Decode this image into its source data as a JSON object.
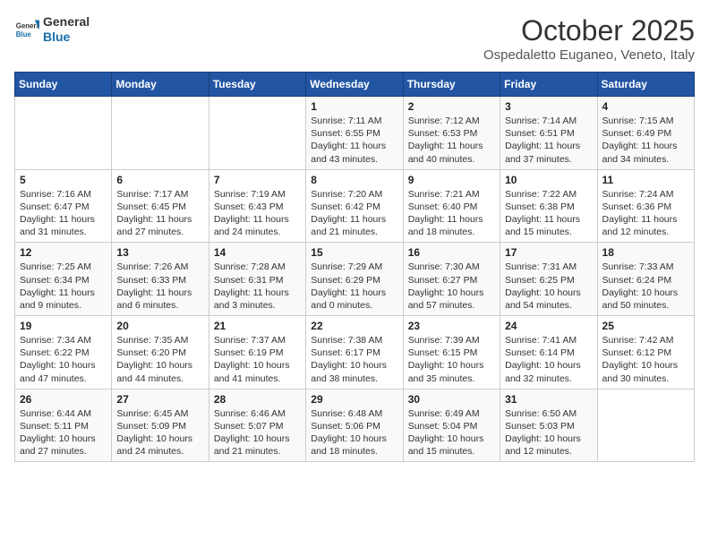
{
  "header": {
    "logo_general": "General",
    "logo_blue": "Blue",
    "month": "October 2025",
    "location": "Ospedaletto Euganeo, Veneto, Italy"
  },
  "weekdays": [
    "Sunday",
    "Monday",
    "Tuesday",
    "Wednesday",
    "Thursday",
    "Friday",
    "Saturday"
  ],
  "weeks": [
    [
      {
        "day": "",
        "info": ""
      },
      {
        "day": "",
        "info": ""
      },
      {
        "day": "",
        "info": ""
      },
      {
        "day": "1",
        "sunrise": "7:11 AM",
        "sunset": "6:55 PM",
        "daylight": "11 hours and 43 minutes."
      },
      {
        "day": "2",
        "sunrise": "7:12 AM",
        "sunset": "6:53 PM",
        "daylight": "11 hours and 40 minutes."
      },
      {
        "day": "3",
        "sunrise": "7:14 AM",
        "sunset": "6:51 PM",
        "daylight": "11 hours and 37 minutes."
      },
      {
        "day": "4",
        "sunrise": "7:15 AM",
        "sunset": "6:49 PM",
        "daylight": "11 hours and 34 minutes."
      }
    ],
    [
      {
        "day": "5",
        "sunrise": "7:16 AM",
        "sunset": "6:47 PM",
        "daylight": "11 hours and 31 minutes."
      },
      {
        "day": "6",
        "sunrise": "7:17 AM",
        "sunset": "6:45 PM",
        "daylight": "11 hours and 27 minutes."
      },
      {
        "day": "7",
        "sunrise": "7:19 AM",
        "sunset": "6:43 PM",
        "daylight": "11 hours and 24 minutes."
      },
      {
        "day": "8",
        "sunrise": "7:20 AM",
        "sunset": "6:42 PM",
        "daylight": "11 hours and 21 minutes."
      },
      {
        "day": "9",
        "sunrise": "7:21 AM",
        "sunset": "6:40 PM",
        "daylight": "11 hours and 18 minutes."
      },
      {
        "day": "10",
        "sunrise": "7:22 AM",
        "sunset": "6:38 PM",
        "daylight": "11 hours and 15 minutes."
      },
      {
        "day": "11",
        "sunrise": "7:24 AM",
        "sunset": "6:36 PM",
        "daylight": "11 hours and 12 minutes."
      }
    ],
    [
      {
        "day": "12",
        "sunrise": "7:25 AM",
        "sunset": "6:34 PM",
        "daylight": "11 hours and 9 minutes."
      },
      {
        "day": "13",
        "sunrise": "7:26 AM",
        "sunset": "6:33 PM",
        "daylight": "11 hours and 6 minutes."
      },
      {
        "day": "14",
        "sunrise": "7:28 AM",
        "sunset": "6:31 PM",
        "daylight": "11 hours and 3 minutes."
      },
      {
        "day": "15",
        "sunrise": "7:29 AM",
        "sunset": "6:29 PM",
        "daylight": "11 hours and 0 minutes."
      },
      {
        "day": "16",
        "sunrise": "7:30 AM",
        "sunset": "6:27 PM",
        "daylight": "10 hours and 57 minutes."
      },
      {
        "day": "17",
        "sunrise": "7:31 AM",
        "sunset": "6:25 PM",
        "daylight": "10 hours and 54 minutes."
      },
      {
        "day": "18",
        "sunrise": "7:33 AM",
        "sunset": "6:24 PM",
        "daylight": "10 hours and 50 minutes."
      }
    ],
    [
      {
        "day": "19",
        "sunrise": "7:34 AM",
        "sunset": "6:22 PM",
        "daylight": "10 hours and 47 minutes."
      },
      {
        "day": "20",
        "sunrise": "7:35 AM",
        "sunset": "6:20 PM",
        "daylight": "10 hours and 44 minutes."
      },
      {
        "day": "21",
        "sunrise": "7:37 AM",
        "sunset": "6:19 PM",
        "daylight": "10 hours and 41 minutes."
      },
      {
        "day": "22",
        "sunrise": "7:38 AM",
        "sunset": "6:17 PM",
        "daylight": "10 hours and 38 minutes."
      },
      {
        "day": "23",
        "sunrise": "7:39 AM",
        "sunset": "6:15 PM",
        "daylight": "10 hours and 35 minutes."
      },
      {
        "day": "24",
        "sunrise": "7:41 AM",
        "sunset": "6:14 PM",
        "daylight": "10 hours and 32 minutes."
      },
      {
        "day": "25",
        "sunrise": "7:42 AM",
        "sunset": "6:12 PM",
        "daylight": "10 hours and 30 minutes."
      }
    ],
    [
      {
        "day": "26",
        "sunrise": "6:44 AM",
        "sunset": "5:11 PM",
        "daylight": "10 hours and 27 minutes."
      },
      {
        "day": "27",
        "sunrise": "6:45 AM",
        "sunset": "5:09 PM",
        "daylight": "10 hours and 24 minutes."
      },
      {
        "day": "28",
        "sunrise": "6:46 AM",
        "sunset": "5:07 PM",
        "daylight": "10 hours and 21 minutes."
      },
      {
        "day": "29",
        "sunrise": "6:48 AM",
        "sunset": "5:06 PM",
        "daylight": "10 hours and 18 minutes."
      },
      {
        "day": "30",
        "sunrise": "6:49 AM",
        "sunset": "5:04 PM",
        "daylight": "10 hours and 15 minutes."
      },
      {
        "day": "31",
        "sunrise": "6:50 AM",
        "sunset": "5:03 PM",
        "daylight": "10 hours and 12 minutes."
      },
      {
        "day": "",
        "info": ""
      }
    ]
  ]
}
